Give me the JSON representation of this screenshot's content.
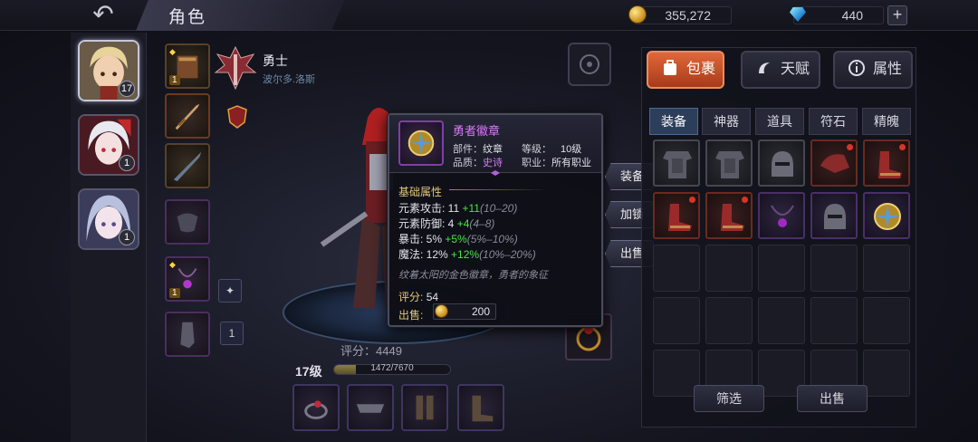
{
  "header": {
    "title": "角色",
    "back_icon": "back-arrow-icon"
  },
  "currency": {
    "gold": "355,272",
    "gems": "440",
    "add_label": "+"
  },
  "heroes": [
    {
      "name": "hero-1",
      "level": "17",
      "active": true
    },
    {
      "name": "hero-2",
      "level": "1",
      "active": false
    },
    {
      "name": "hero-3",
      "level": "1",
      "active": false
    }
  ],
  "character": {
    "class_name": "勇士",
    "subtitle": "波尔多.洛斯",
    "score_label": "评分：4449",
    "level_label": "17级",
    "exp_text": "1472/7670",
    "exp_fraction": 0.19,
    "slot_count_box": "1",
    "slot_badge": "1"
  },
  "tooltip": {
    "name": "勇者徽章",
    "part_label": "部件：",
    "part_value": "纹章",
    "grade_label": "等级：",
    "grade_value": "10级",
    "quality_label": "品质：",
    "quality_value": "史诗",
    "job_label": "职业：",
    "job_value": "所有职业",
    "section_title": "基础属性",
    "stats": [
      {
        "label": "元素攻击: 11",
        "add": "+11",
        "range": "(10–20)"
      },
      {
        "label": "元素防御: 4",
        "add": "+4",
        "range": "(4–8)"
      },
      {
        "label": "暴击: 5%",
        "add": "+5%",
        "range": "(5%–10%)"
      },
      {
        "label": "魔法: 12%",
        "add": "+12%",
        "range": "(10%–20%)"
      }
    ],
    "description": "纹着太阳的金色徽章，勇者的象征",
    "score_label": "评分:",
    "score_value": "54",
    "sell_label": "出售:",
    "sell_price": "200"
  },
  "actions": {
    "equip": "装备",
    "enhance": "加锁",
    "sell": "出售"
  },
  "categories": [
    {
      "label": "包裹",
      "icon": "bag-icon",
      "active": true
    },
    {
      "label": "天赋",
      "icon": "talent-icon",
      "active": false
    },
    {
      "label": "属性",
      "icon": "info-icon",
      "active": false
    }
  ],
  "subtabs": [
    {
      "label": "装备",
      "active": true
    },
    {
      "label": "神器",
      "active": false
    },
    {
      "label": "道具",
      "active": false
    },
    {
      "label": "符石",
      "active": false
    },
    {
      "label": "精魄",
      "active": false
    }
  ],
  "inventory": {
    "items": [
      {
        "icon": "armor-icon",
        "rarity": "gray"
      },
      {
        "icon": "armor-icon",
        "rarity": "gray"
      },
      {
        "icon": "helmet-icon",
        "rarity": "gray"
      },
      {
        "icon": "shoulder-icon",
        "rarity": "orange",
        "new": true
      },
      {
        "icon": "boots-icon",
        "rarity": "orange",
        "new": true
      },
      {
        "icon": "boots-icon",
        "rarity": "orange",
        "new": true
      },
      {
        "icon": "boots-icon",
        "rarity": "orange",
        "new": true
      },
      {
        "icon": "necklace-icon",
        "rarity": "purple"
      },
      {
        "icon": "helmet-icon",
        "rarity": "purple"
      },
      {
        "icon": "emblem-icon",
        "rarity": "purple"
      }
    ],
    "filter_label": "筛选",
    "sell_label": "出售"
  },
  "colors": {
    "accent": "#e0683a",
    "epic": "#d77bf5",
    "bonus": "#4be34b",
    "gold_text": "#e2c77a"
  }
}
